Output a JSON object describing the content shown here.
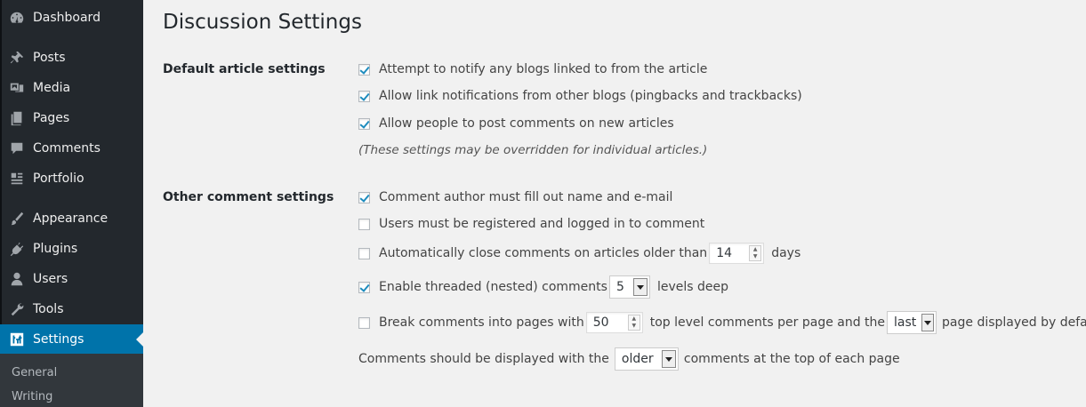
{
  "sidebar": {
    "items": [
      {
        "label": "Dashboard",
        "icon": "dashboard-icon"
      },
      {
        "label": "Posts",
        "icon": "pin-icon"
      },
      {
        "label": "Media",
        "icon": "media-icon"
      },
      {
        "label": "Pages",
        "icon": "pages-icon"
      },
      {
        "label": "Comments",
        "icon": "comment-icon"
      },
      {
        "label": "Portfolio",
        "icon": "portfolio-icon"
      },
      {
        "label": "Appearance",
        "icon": "brush-icon"
      },
      {
        "label": "Plugins",
        "icon": "plugin-icon"
      },
      {
        "label": "Users",
        "icon": "user-icon"
      },
      {
        "label": "Tools",
        "icon": "wrench-icon"
      },
      {
        "label": "Settings",
        "icon": "settings-icon",
        "current": true
      }
    ],
    "submenu": [
      "General",
      "Writing"
    ]
  },
  "page": {
    "title": "Discussion Settings"
  },
  "default_article": {
    "label": "Default article settings",
    "options": [
      {
        "label": "Attempt to notify any blogs linked to from the article",
        "checked": true
      },
      {
        "label": "Allow link notifications from other blogs (pingbacks and trackbacks)",
        "checked": true
      },
      {
        "label": "Allow people to post comments on new articles",
        "checked": true
      }
    ],
    "note": "(These settings may be overridden for individual articles.)"
  },
  "other_comment": {
    "label": "Other comment settings",
    "require_name_email": {
      "label": "Comment author must fill out name and e-mail",
      "checked": true
    },
    "registered_only": {
      "label": "Users must be registered and logged in to comment",
      "checked": false
    },
    "auto_close": {
      "label_before": "Automatically close comments on articles older than",
      "value": "14",
      "label_after": "days",
      "checked": false
    },
    "threaded": {
      "label_before": "Enable threaded (nested) comments",
      "value": "5",
      "label_after": "levels deep",
      "checked": true
    },
    "paging": {
      "label_before": "Break comments into pages with",
      "value": "50",
      "label_middle": "top level comments per page and the",
      "page_select": "last",
      "label_after": "page displayed by default",
      "checked": false
    },
    "order": {
      "label_before": "Comments should be displayed with the",
      "value": "older",
      "label_after": "comments at the top of each page"
    }
  },
  "colors": {
    "sidebar_bg": "#23282d",
    "accent": "#0073aa",
    "page_bg": "#f1f1f1"
  }
}
